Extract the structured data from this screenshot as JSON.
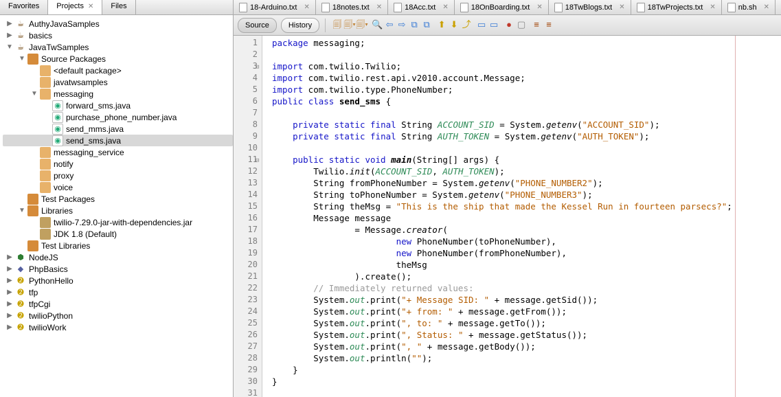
{
  "left_tabs": {
    "favorites": "Favorites",
    "projects": "Projects",
    "files": "Files"
  },
  "tree": [
    {
      "d": 0,
      "t": "l",
      "exp": true,
      "i": "i-proj",
      "g": "☕︎",
      "lbl": "AuthyJavaSamples"
    },
    {
      "d": 0,
      "t": "l",
      "exp": true,
      "i": "i-proj",
      "g": "☕︎",
      "lbl": "basics"
    },
    {
      "d": 0,
      "t": "l",
      "exp": true,
      "i": "i-proj",
      "g": "☕︎",
      "lbl": "JavaTwSamples",
      "open": true
    },
    {
      "d": 1,
      "t": "b",
      "exp": true,
      "i": "i-pkgroot",
      "g": " ",
      "lbl": "Source Packages",
      "open": true
    },
    {
      "d": 2,
      "t": "b",
      "exp": false,
      "i": "i-pkg",
      "g": " ",
      "lbl": "<default package>"
    },
    {
      "d": 2,
      "t": "b",
      "exp": false,
      "i": "i-pkg",
      "g": " ",
      "lbl": "javatwsamples"
    },
    {
      "d": 2,
      "t": "b",
      "exp": true,
      "i": "i-pkg",
      "g": " ",
      "lbl": "messaging",
      "open": true
    },
    {
      "d": 3,
      "t": "l",
      "i": "i-java",
      "g": "◉",
      "lbl": "forward_sms.java"
    },
    {
      "d": 3,
      "t": "l",
      "i": "i-java",
      "g": "◉",
      "lbl": "purchase_phone_number.java"
    },
    {
      "d": 3,
      "t": "l",
      "i": "i-java",
      "g": "◉",
      "lbl": "send_mms.java"
    },
    {
      "d": 3,
      "t": "l",
      "i": "i-java",
      "g": "◉",
      "lbl": "send_sms.java",
      "sel": true
    },
    {
      "d": 2,
      "t": "b",
      "exp": false,
      "i": "i-pkg",
      "g": " ",
      "lbl": "messaging_service"
    },
    {
      "d": 2,
      "t": "b",
      "exp": false,
      "i": "i-pkg",
      "g": " ",
      "lbl": "notify"
    },
    {
      "d": 2,
      "t": "b",
      "exp": false,
      "i": "i-pkg",
      "g": " ",
      "lbl": "proxy"
    },
    {
      "d": 2,
      "t": "b",
      "exp": false,
      "i": "i-pkg",
      "g": " ",
      "lbl": "voice"
    },
    {
      "d": 1,
      "t": "b",
      "exp": false,
      "i": "i-pkgroot",
      "g": " ",
      "lbl": "Test Packages"
    },
    {
      "d": 1,
      "t": "b",
      "exp": true,
      "i": "i-lib",
      "g": " ",
      "lbl": "Libraries",
      "open": true
    },
    {
      "d": 2,
      "t": "b",
      "exp": false,
      "i": "i-jar",
      "g": " ",
      "lbl": "twilio-7.29.0-jar-with-dependencies.jar"
    },
    {
      "d": 2,
      "t": "b",
      "exp": false,
      "i": "i-jar",
      "g": " ",
      "lbl": "JDK 1.8 (Default)"
    },
    {
      "d": 1,
      "t": "b",
      "exp": false,
      "i": "i-pkgroot",
      "g": " ",
      "lbl": "Test Libraries"
    },
    {
      "d": 0,
      "t": "l",
      "exp": true,
      "i": "i-node",
      "g": "⬢",
      "lbl": "NodeJS"
    },
    {
      "d": 0,
      "t": "l",
      "exp": true,
      "i": "i-php",
      "g": "◆",
      "lbl": "PhpBasics"
    },
    {
      "d": 0,
      "t": "l",
      "exp": true,
      "i": "i-py",
      "g": "➋",
      "lbl": "PythonHello"
    },
    {
      "d": 0,
      "t": "l",
      "exp": true,
      "i": "i-py",
      "g": "➋",
      "lbl": "tfp"
    },
    {
      "d": 0,
      "t": "l",
      "exp": true,
      "i": "i-py",
      "g": "➋",
      "lbl": "tfpCgi"
    },
    {
      "d": 0,
      "t": "l",
      "exp": true,
      "i": "i-py",
      "g": "➋",
      "lbl": "twilioPython"
    },
    {
      "d": 0,
      "t": "l",
      "exp": true,
      "i": "i-py",
      "g": "➋",
      "lbl": "twilioWork"
    }
  ],
  "rtabs": [
    "18-Arduino.txt",
    "18notes.txt",
    "18Acc.txt",
    "18OnBoarding.txt",
    "18TwBlogs.txt",
    "18TwProjects.txt",
    "nb.sh"
  ],
  "toolbar": {
    "source": "Source",
    "history": "History"
  },
  "ticons": [
    "🗐",
    "🗐▾",
    "🗐▾",
    "|",
    "🔍",
    "⇦",
    "⇨",
    "⧉",
    "⧉",
    "|",
    "⬆",
    "⬇",
    "⤴",
    "|",
    "▭",
    "▭",
    "|",
    "●",
    "▢",
    "|",
    "≡",
    "≡"
  ],
  "ticon_colors": [
    "#c08030",
    "#c08030",
    "#c08030",
    "",
    "#3a7bd5",
    "#3a7bd5",
    "#3a7bd5",
    "#3a7bd5",
    "#3a7bd5",
    "",
    "#caa000",
    "#caa000",
    "#caa000",
    "",
    "#3a7bd5",
    "#3a7bd5",
    "",
    "#c0392b",
    "#888",
    "",
    "#a04000",
    "#a04000"
  ],
  "line_count": 31,
  "folds": [
    3,
    11
  ],
  "code": [
    [
      [
        "kw",
        "package"
      ],
      [
        "",
        " messaging;"
      ]
    ],
    [],
    [
      [
        "kw",
        "import"
      ],
      [
        "",
        " com.twilio.Twilio;"
      ]
    ],
    [
      [
        "kw",
        "import"
      ],
      [
        "",
        " com.twilio.rest.api.v2010.account.Message;"
      ]
    ],
    [
      [
        "kw",
        "import"
      ],
      [
        "",
        " com.twilio.type.PhoneNumber;"
      ]
    ],
    [
      [
        "kw",
        "public"
      ],
      [
        "",
        " "
      ],
      [
        "kw",
        "class"
      ],
      [
        "",
        " "
      ],
      [
        "bold",
        "send_sms"
      ],
      [
        "",
        " {"
      ]
    ],
    [],
    [
      [
        "",
        "    "
      ],
      [
        "kw",
        "private"
      ],
      [
        "",
        " "
      ],
      [
        "kw",
        "static"
      ],
      [
        "",
        " "
      ],
      [
        "kw",
        "final"
      ],
      [
        "",
        " String "
      ],
      [
        "id-it",
        "ACCOUNT_SID"
      ],
      [
        "",
        " = System."
      ],
      [
        "it",
        "getenv"
      ],
      [
        "",
        "("
      ],
      [
        "str",
        "\"ACCOUNT_SID\""
      ],
      [
        "",
        ");"
      ]
    ],
    [
      [
        "",
        "    "
      ],
      [
        "kw",
        "private"
      ],
      [
        "",
        " "
      ],
      [
        "kw",
        "static"
      ],
      [
        "",
        " "
      ],
      [
        "kw",
        "final"
      ],
      [
        "",
        " String "
      ],
      [
        "id-it",
        "AUTH_TOKEN"
      ],
      [
        "",
        " = System."
      ],
      [
        "it",
        "getenv"
      ],
      [
        "",
        "("
      ],
      [
        "str",
        "\"AUTH_TOKEN\""
      ],
      [
        "",
        ");"
      ]
    ],
    [],
    [
      [
        "",
        "    "
      ],
      [
        "kw",
        "public"
      ],
      [
        "",
        " "
      ],
      [
        "kw",
        "static"
      ],
      [
        "",
        " "
      ],
      [
        "kw",
        "void"
      ],
      [
        "",
        " "
      ],
      [
        "bold it",
        "main"
      ],
      [
        "",
        "(String[] args) {"
      ]
    ],
    [
      [
        "",
        "        Twilio."
      ],
      [
        "it",
        "init"
      ],
      [
        "",
        "("
      ],
      [
        "id-it",
        "ACCOUNT_SID"
      ],
      [
        "",
        ", "
      ],
      [
        "id-it",
        "AUTH_TOKEN"
      ],
      [
        "",
        ");"
      ]
    ],
    [
      [
        "",
        "        String fromPhoneNumber = System."
      ],
      [
        "it",
        "getenv"
      ],
      [
        "",
        "("
      ],
      [
        "str",
        "\"PHONE_NUMBER2\""
      ],
      [
        "",
        ");"
      ]
    ],
    [
      [
        "",
        "        String toPhoneNumber = System."
      ],
      [
        "it",
        "getenv"
      ],
      [
        "",
        "("
      ],
      [
        "str",
        "\"PHONE_NUMBER3\""
      ],
      [
        "",
        ");"
      ]
    ],
    [
      [
        "",
        "        String theMsg = "
      ],
      [
        "str",
        "\"This is the ship that made the Kessel Run in fourteen parsecs?\""
      ],
      [
        "",
        ";"
      ]
    ],
    [
      [
        "",
        "        Message message"
      ]
    ],
    [
      [
        "",
        "                = Message."
      ],
      [
        "it",
        "creator"
      ],
      [
        "",
        "("
      ]
    ],
    [
      [
        "",
        "                        "
      ],
      [
        "kw",
        "new"
      ],
      [
        "",
        " PhoneNumber(toPhoneNumber),"
      ]
    ],
    [
      [
        "",
        "                        "
      ],
      [
        "kw",
        "new"
      ],
      [
        "",
        " PhoneNumber(fromPhoneNumber),"
      ]
    ],
    [
      [
        "",
        "                        theMsg"
      ]
    ],
    [
      [
        "",
        "                ).create();"
      ]
    ],
    [
      [
        "",
        "        "
      ],
      [
        "cmt",
        "// Immediately returned values:"
      ]
    ],
    [
      [
        "",
        "        System."
      ],
      [
        "id-it",
        "out"
      ],
      [
        "",
        ".print("
      ],
      [
        "str",
        "\"+ Message SID: \""
      ],
      [
        "",
        " + message.getSid());"
      ]
    ],
    [
      [
        "",
        "        System."
      ],
      [
        "id-it",
        "out"
      ],
      [
        "",
        ".print("
      ],
      [
        "str",
        "\"+ from: \""
      ],
      [
        "",
        " + message.getFrom());"
      ]
    ],
    [
      [
        "",
        "        System."
      ],
      [
        "id-it",
        "out"
      ],
      [
        "",
        ".print("
      ],
      [
        "str",
        "\", to: \""
      ],
      [
        "",
        " + message.getTo());"
      ]
    ],
    [
      [
        "",
        "        System."
      ],
      [
        "id-it",
        "out"
      ],
      [
        "",
        ".print("
      ],
      [
        "str",
        "\", Status: \""
      ],
      [
        "",
        " + message.getStatus());"
      ]
    ],
    [
      [
        "",
        "        System."
      ],
      [
        "id-it",
        "out"
      ],
      [
        "",
        ".print("
      ],
      [
        "str",
        "\", \""
      ],
      [
        "",
        " + message.getBody());"
      ]
    ],
    [
      [
        "",
        "        System."
      ],
      [
        "id-it",
        "out"
      ],
      [
        "",
        ".println("
      ],
      [
        "str",
        "\"\""
      ],
      [
        "",
        ");"
      ]
    ],
    [
      [
        "",
        "    }"
      ]
    ],
    [
      [
        "",
        "}"
      ]
    ],
    []
  ]
}
